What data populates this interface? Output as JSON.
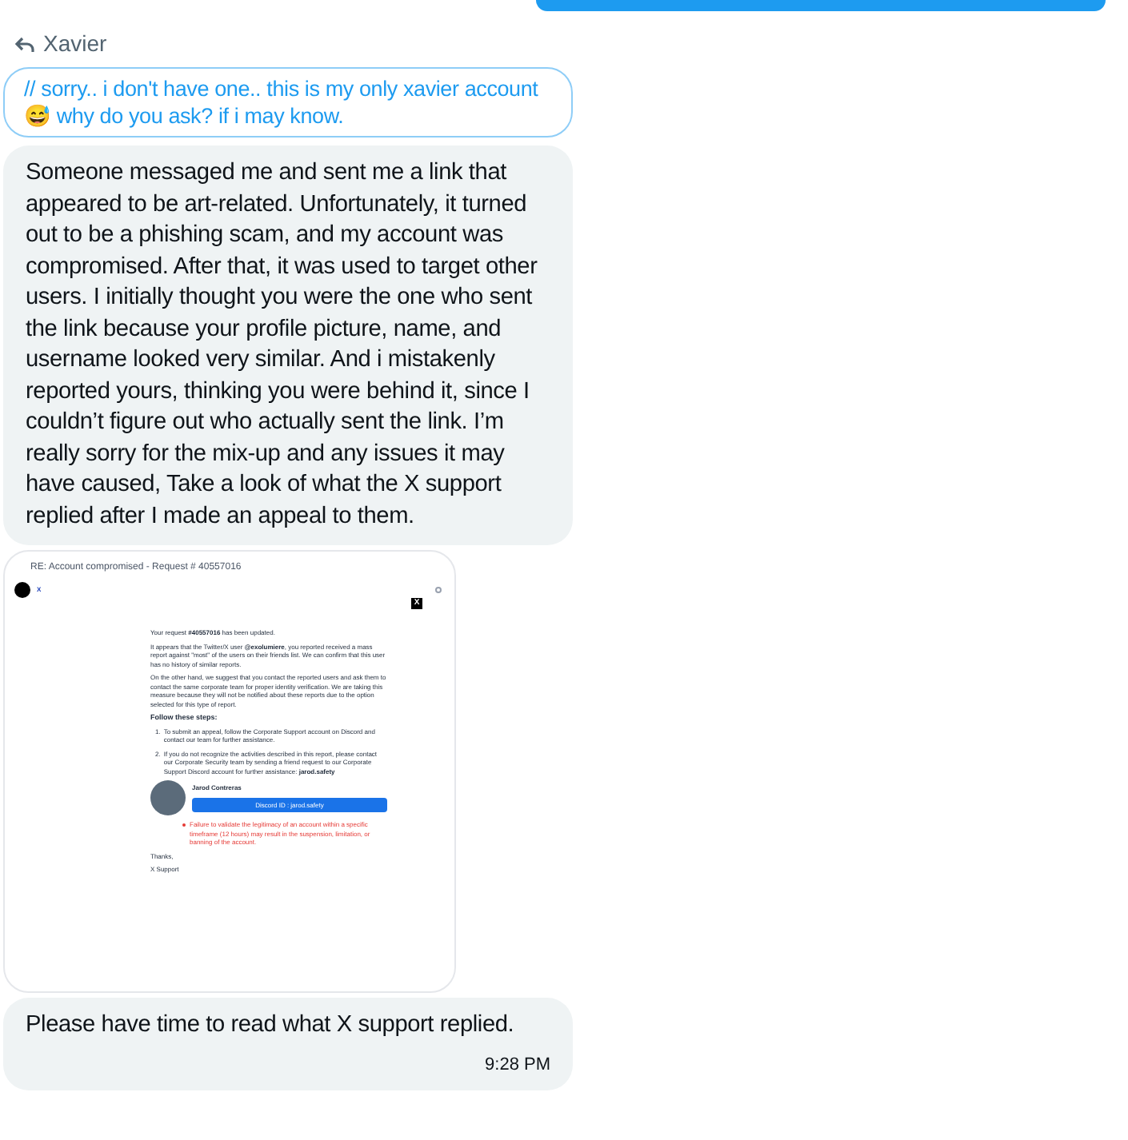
{
  "reply_header": {
    "name": "Xavier"
  },
  "quoted_message": {
    "text": "// sorry.. i don't have one.. this is my only xavier account 😅 why do you ask? if i may know."
  },
  "messages": [
    {
      "kind": "text",
      "text": "Someone messaged me and sent me a link that appeared to be art-related. Unfortunately, it turned out to be a phishing scam, and my account was compromised. After that, it was used to target other users. I initially thought you were the one who sent the link because your profile picture, name, and username looked very similar. And i mistakenly reported yours, thinking you were behind it, since I couldn’t figure out who actually sent the link. I’m really sorry for the mix-up and any issues it may have caused, Take a look of what the X support replied after I made an appeal to them."
    },
    {
      "kind": "email",
      "subject": "RE: Account compromised - Request # 40557016",
      "sender": "X",
      "logo": "X",
      "paragraphs": [
        "Your request **#40557016** has been updated.",
        "It appears that the Twitter/X user **@exolumiere**, you reported received a mass report against \"most\" of the users on their friends list. We can confirm that this user has no history of similar reports.",
        "On the other hand, we suggest that you contact the reported users and ask them to contact the same corporate team for proper identity verification. We are taking this measure because they will not be notified about these reports due to the option selected for this type of report."
      ],
      "steps_title": "Follow these steps:",
      "step_numbers": [
        "1.",
        "2."
      ],
      "steps": [
        "To submit an appeal, follow the Corporate Support account on Discord and contact our team for further assistance.",
        "If you do not recognize the activities described in this report, please contact our Corporate Security team by sending a friend request to our Corporate Support Discord account for further assistance: **jarod.safety**"
      ],
      "agent_name": "Jarod Contreras",
      "agent_button": "Discord ID : jarod.safety",
      "warning": "Failure to validate the legitimacy of an account within a specific timeframe (12 hours) may result in the suspension, limitation, or banning of the account.",
      "closing": "Thanks,",
      "signature": "X Support"
    },
    {
      "kind": "text",
      "text": "Please have time to read what X support replied.",
      "time": "9:28 PM"
    }
  ]
}
